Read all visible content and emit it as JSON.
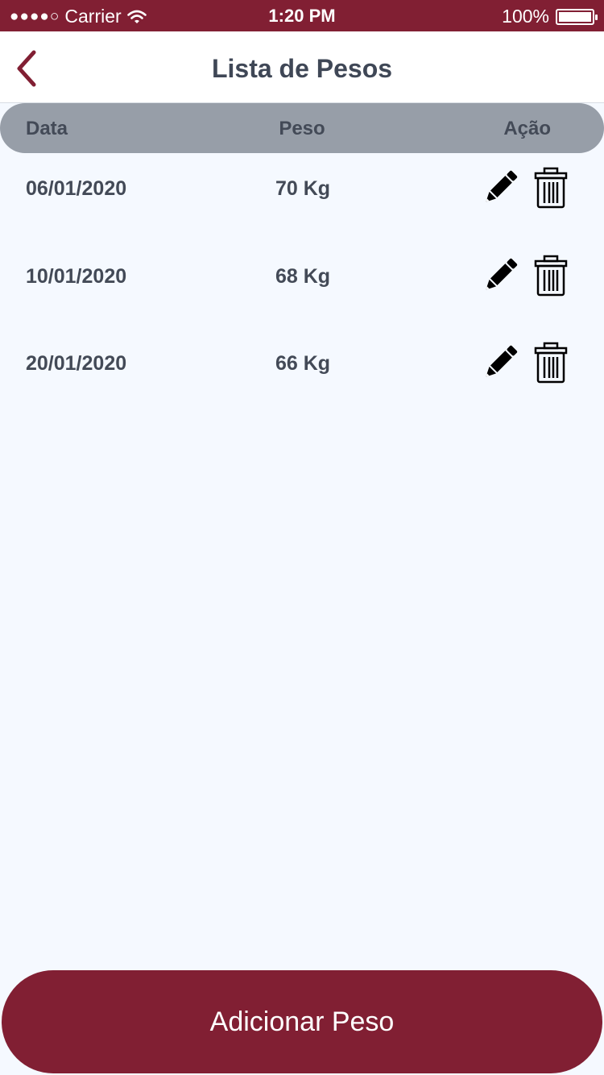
{
  "status_bar": {
    "signal": "●●●●○",
    "carrier": "Carrier",
    "time": "1:20 PM",
    "battery": "100%"
  },
  "nav": {
    "title": "Lista de Pesos"
  },
  "table": {
    "headers": [
      "Data",
      "Peso",
      "Ação"
    ],
    "rows": [
      {
        "date": "06/01/2020",
        "weight": "70 Kg"
      },
      {
        "date": "10/01/2020",
        "weight": "68 Kg"
      },
      {
        "date": "20/01/2020",
        "weight": "66 Kg"
      }
    ]
  },
  "add_button": {
    "label": "Adicionar Peso"
  },
  "colors": {
    "brand": "#811f33",
    "header_bg": "#979ea8",
    "text": "#434a57",
    "background": "#f5f9ff"
  }
}
